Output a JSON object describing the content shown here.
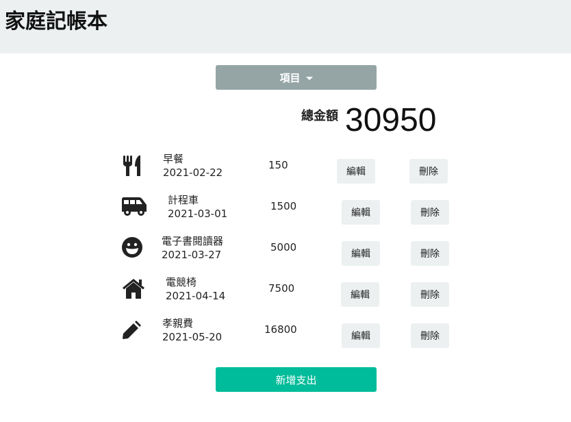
{
  "header": {
    "title": "家庭記帳本"
  },
  "filter": {
    "dropdown_label": "項目"
  },
  "summary": {
    "total_label": "總金額",
    "total_value": "30950"
  },
  "expenses": [
    {
      "icon": "utensils-icon",
      "name": "早餐",
      "date": "2021-02-22",
      "amount": "150",
      "edit_label": "編輯",
      "delete_label": "刪除"
    },
    {
      "icon": "shuttle-van-icon",
      "name": "計程車",
      "date": "2021-03-01",
      "amount": "1500",
      "edit_label": "編輯",
      "delete_label": "刪除"
    },
    {
      "icon": "grin-icon",
      "name": "電子書閱讀器",
      "date": "2021-03-27",
      "amount": "5000",
      "edit_label": "編輯",
      "delete_label": "刪除"
    },
    {
      "icon": "home-icon",
      "name": "電競椅",
      "date": "2021-04-14",
      "amount": "7500",
      "edit_label": "編輯",
      "delete_label": "刪除"
    },
    {
      "icon": "pencil-icon",
      "name": "孝親費",
      "date": "2021-05-20",
      "amount": "16800",
      "edit_label": "編輯",
      "delete_label": "刪除"
    }
  ],
  "actions": {
    "add_label": "新增支出"
  },
  "colors": {
    "header_bg": "#ecf0f1",
    "dropdown_bg": "#95a5a6",
    "primary": "#00bc9a",
    "light_button": "#ecf0f1"
  }
}
